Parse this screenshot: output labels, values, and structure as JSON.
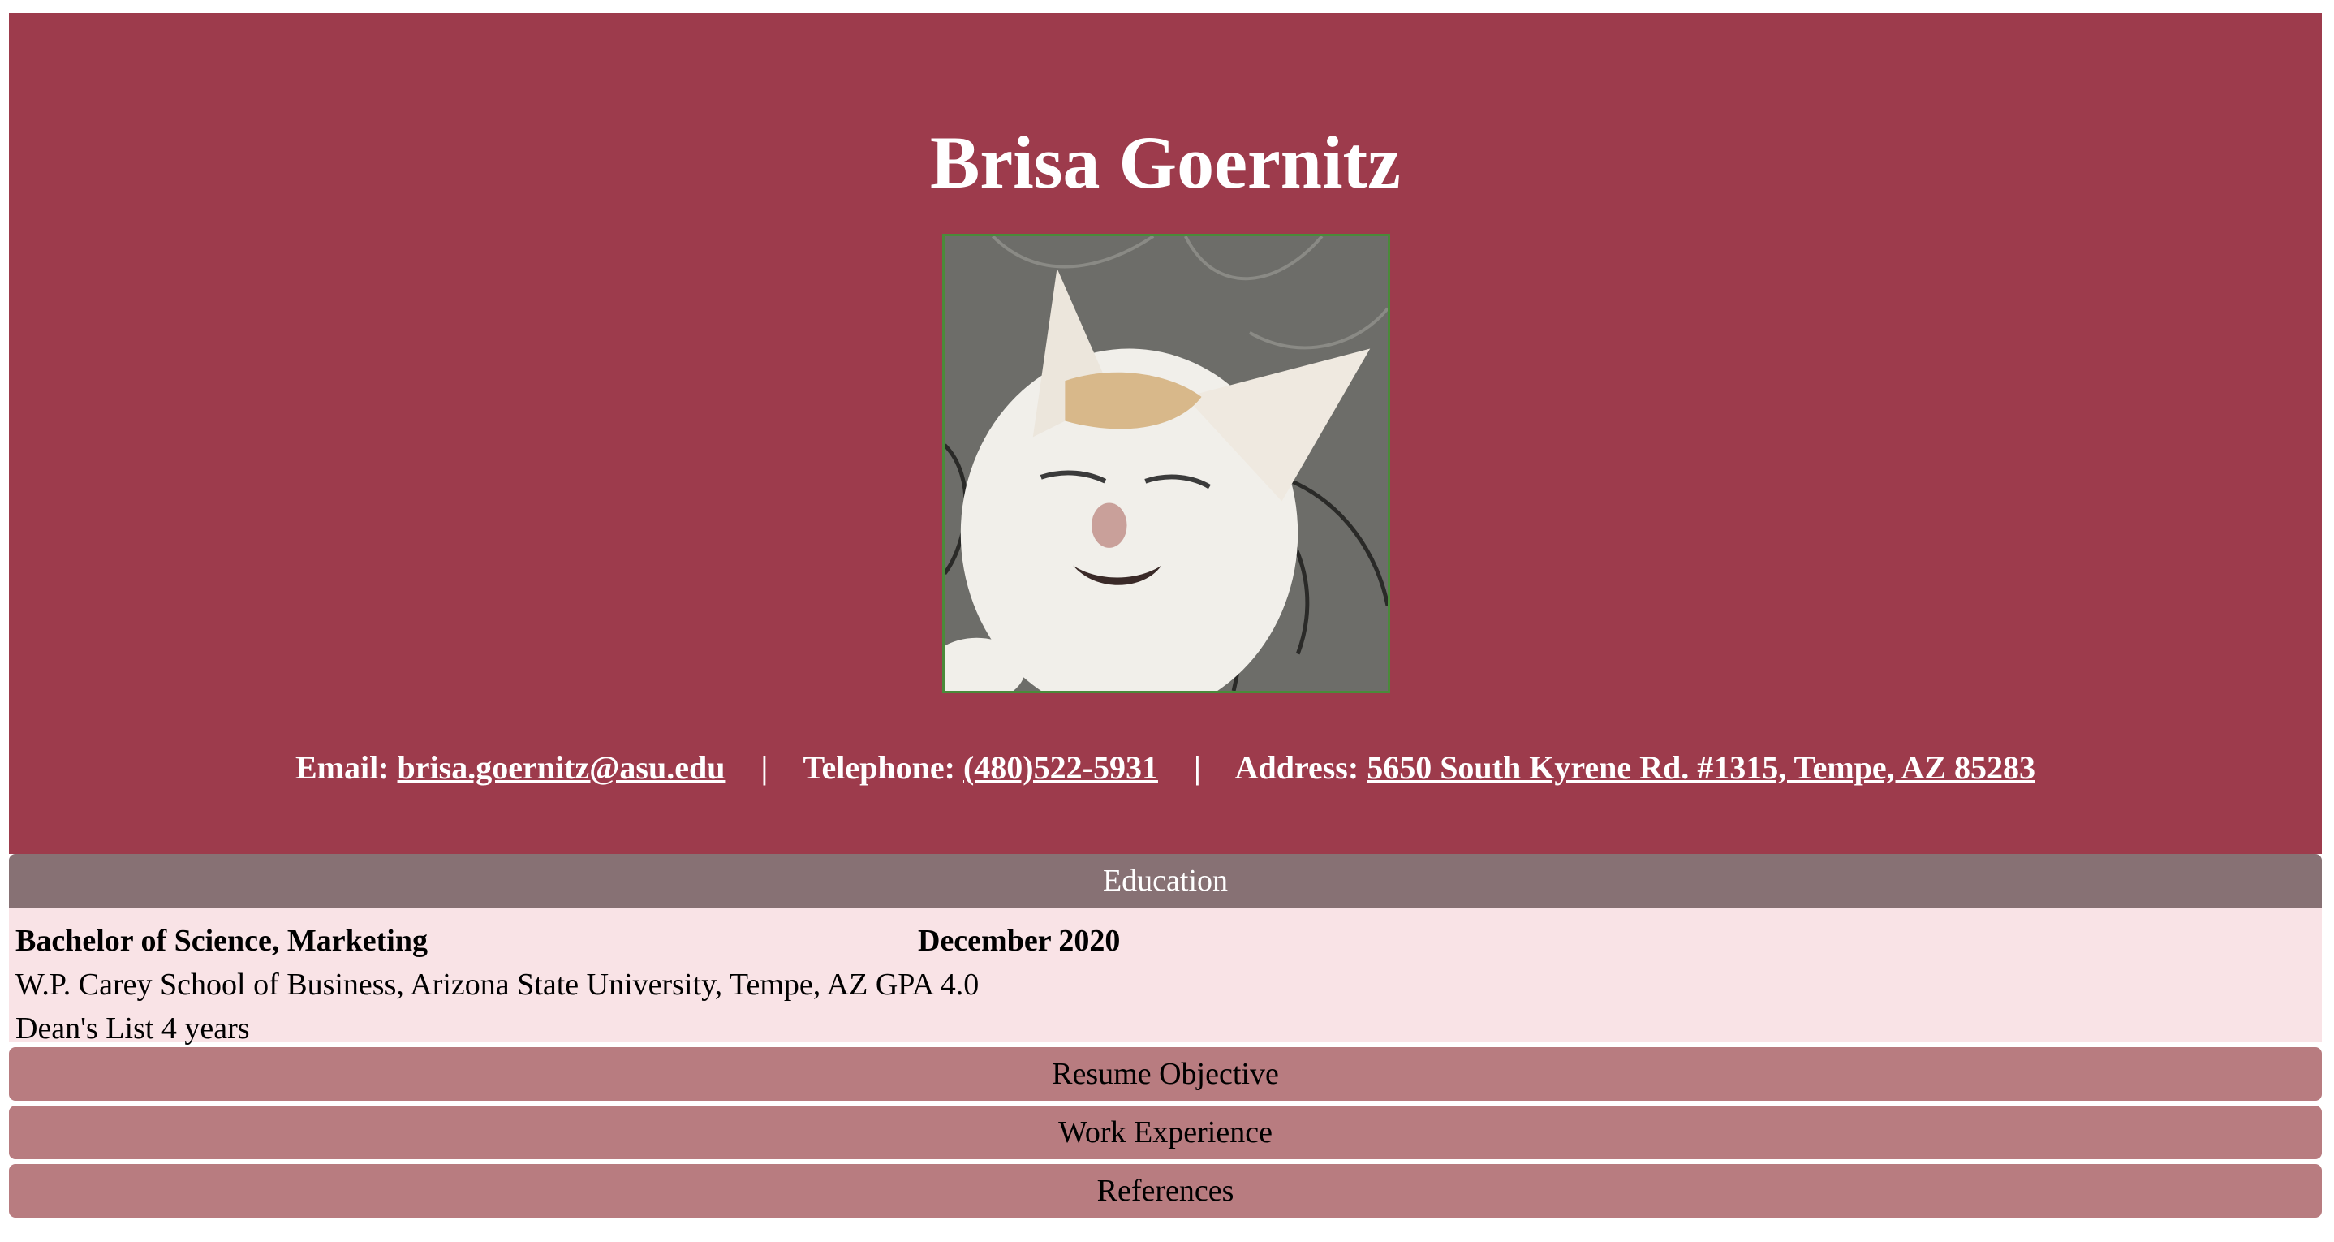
{
  "header": {
    "name": "Brisa Goernitz",
    "photo_alt": "cat photo",
    "contact": {
      "email_label": "Email:",
      "email_value": "brisa.goernitz@asu.edu",
      "separator": "|",
      "phone_label": "Telephone:",
      "phone_value": "(480)522-5931",
      "address_label": "Address:",
      "address_value": "5650 South Kyrene Rd. #1315, Tempe, AZ 85283"
    }
  },
  "education": {
    "heading": "Education",
    "degree": "Bachelor of Science, Marketing",
    "date": "December 2020",
    "school": "W.P. Carey School of Business, Arizona State University, Tempe, AZ GPA 4.0",
    "honors": "Dean's List 4 years"
  },
  "sections": [
    {
      "heading": "Resume Objective"
    },
    {
      "heading": "Work Experience"
    },
    {
      "heading": "References"
    }
  ],
  "colors": {
    "header_bg": "#9d3b4c",
    "education_head_bg": "#877174",
    "education_body_bg": "#f9e3e6",
    "section_head_bg": "#b87c80"
  }
}
